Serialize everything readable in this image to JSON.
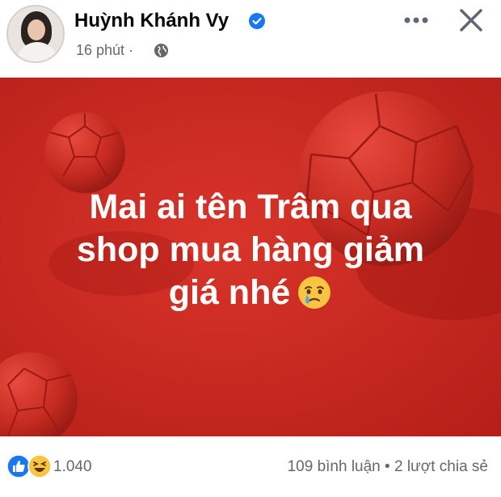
{
  "post": {
    "author_name": "Huỳnh Khánh Vy",
    "timestamp": "16 phút ·",
    "icons": {
      "verified": "verified-badge-icon",
      "audience": "globe-icon",
      "more": "more-options-icon",
      "close": "close-icon"
    },
    "image_text": {
      "line1": "Mai ai tên Trâm qua",
      "line2": "shop mua hàng giảm",
      "line3": "giá nhé",
      "emoji": "crying-face-emoji"
    },
    "reactions": {
      "types": [
        "like",
        "haha"
      ],
      "count": "1.040"
    },
    "stats": {
      "comments": "109 bình luận",
      "separator": " • ",
      "shares": "2 lượt chia sẻ"
    },
    "colors": {
      "background_red": "#c8271f",
      "verified_blue": "#1877f2",
      "text_secondary": "#65676b"
    }
  }
}
